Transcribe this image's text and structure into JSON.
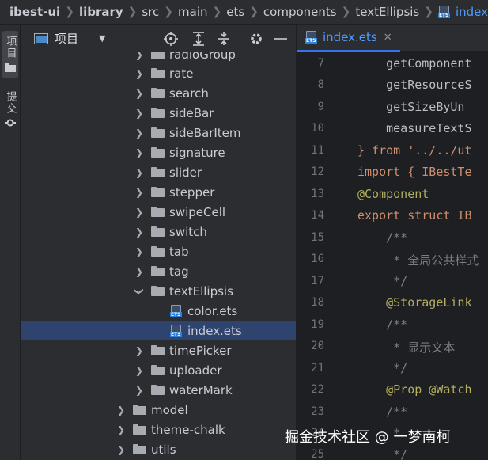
{
  "breadcrumb": [
    "ibest-ui",
    "library",
    "src",
    "main",
    "ets",
    "components",
    "textEllipsis",
    "index.ets"
  ],
  "left_strip": {
    "project_label": "项目",
    "commit_label": "提交"
  },
  "project_panel": {
    "title": "项目",
    "tree": [
      {
        "label": "radioGroup",
        "type": "folder",
        "indent": 1,
        "collapsed": true
      },
      {
        "label": "rate",
        "type": "folder",
        "indent": 1,
        "collapsed": true
      },
      {
        "label": "search",
        "type": "folder",
        "indent": 1,
        "collapsed": true
      },
      {
        "label": "sideBar",
        "type": "folder",
        "indent": 1,
        "collapsed": true
      },
      {
        "label": "sideBarItem",
        "type": "folder",
        "indent": 1,
        "collapsed": true
      },
      {
        "label": "signature",
        "type": "folder",
        "indent": 1,
        "collapsed": true
      },
      {
        "label": "slider",
        "type": "folder",
        "indent": 1,
        "collapsed": true
      },
      {
        "label": "stepper",
        "type": "folder",
        "indent": 1,
        "collapsed": true
      },
      {
        "label": "swipeCell",
        "type": "folder",
        "indent": 1,
        "collapsed": true
      },
      {
        "label": "switch",
        "type": "folder",
        "indent": 1,
        "collapsed": true
      },
      {
        "label": "tab",
        "type": "folder",
        "indent": 1,
        "collapsed": true
      },
      {
        "label": "tag",
        "type": "folder",
        "indent": 1,
        "collapsed": true
      },
      {
        "label": "textEllipsis",
        "type": "folder",
        "indent": 1,
        "collapsed": false
      },
      {
        "label": "color.ets",
        "type": "file",
        "indent": 2
      },
      {
        "label": "index.ets",
        "type": "file",
        "indent": 2,
        "selected": true
      },
      {
        "label": "timePicker",
        "type": "folder",
        "indent": 1,
        "collapsed": true
      },
      {
        "label": "uploader",
        "type": "folder",
        "indent": 1,
        "collapsed": true
      },
      {
        "label": "waterMark",
        "type": "folder",
        "indent": 1,
        "collapsed": true
      },
      {
        "label": "model",
        "type": "folder",
        "indent": 0,
        "collapsed": true
      },
      {
        "label": "theme-chalk",
        "type": "folder",
        "indent": 0,
        "collapsed": true
      },
      {
        "label": "utils",
        "type": "folder",
        "indent": 0,
        "collapsed": true
      }
    ]
  },
  "editor": {
    "tab_label": "index.ets",
    "lines": [
      {
        "n": "7",
        "text": "    getComponent"
      },
      {
        "n": "8",
        "text": "    getResourceS"
      },
      {
        "n": "9",
        "text": "    getSizeByUn"
      },
      {
        "n": "10",
        "text": "    measureTextS"
      },
      {
        "n": "11",
        "text": "} from '../../ut"
      },
      {
        "n": "12",
        "text": "import { IBestTe"
      },
      {
        "n": "13",
        "text": "@Component"
      },
      {
        "n": "14",
        "text": "export struct IB"
      },
      {
        "n": "15",
        "text": "    /**"
      },
      {
        "n": "16",
        "text": "     * 全局公共样式"
      },
      {
        "n": "17",
        "text": "     */"
      },
      {
        "n": "18",
        "text": "    @StorageLink"
      },
      {
        "n": "19",
        "text": "    /**"
      },
      {
        "n": "20",
        "text": "     * 显示文本"
      },
      {
        "n": "21",
        "text": "     */"
      },
      {
        "n": "22",
        "text": "    @Prop @Watch"
      },
      {
        "n": "23",
        "text": "    /**"
      },
      {
        "n": "24",
        "text": "     * "
      },
      {
        "n": "25",
        "text": "     */"
      }
    ]
  },
  "watermark": "掘金技术社区 @ 一梦南柯"
}
